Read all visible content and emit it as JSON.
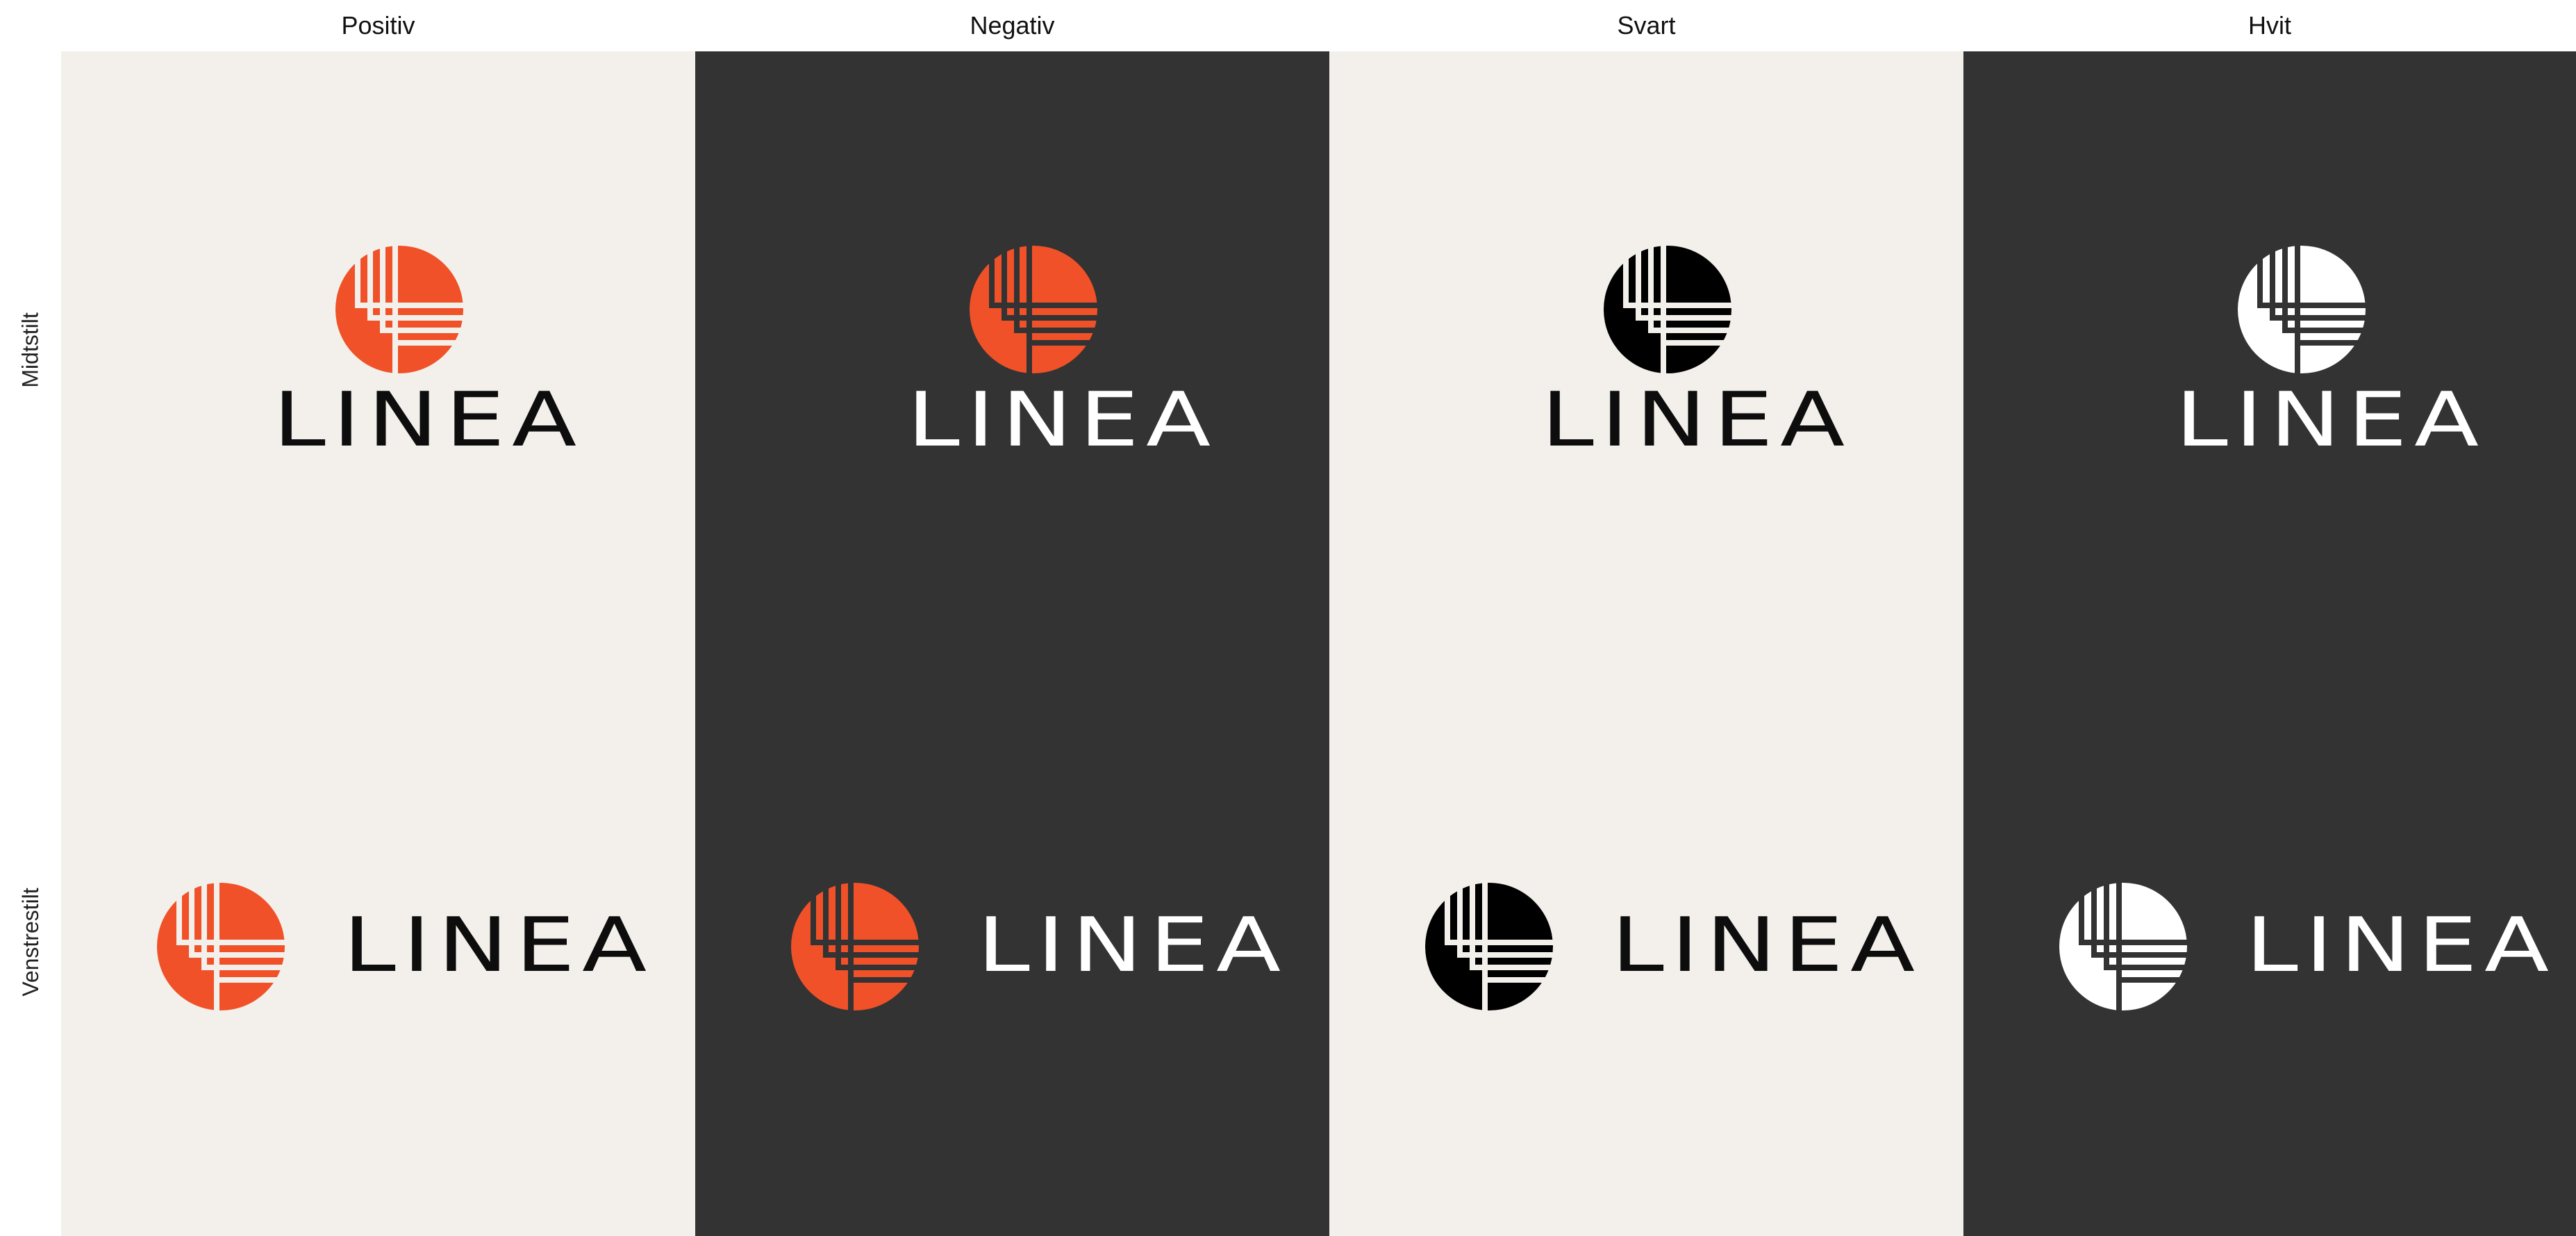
{
  "columns": [
    {
      "label": "Positiv",
      "bg": "#f3f0eb",
      "mark_color": "#f05128",
      "text_color": "#0d0d0d"
    },
    {
      "label": "Negativ",
      "bg": "#333333",
      "mark_color": "#f05128",
      "text_color": "#ffffff"
    },
    {
      "label": "Svart",
      "bg": "#f3f0eb",
      "mark_color": "#000000",
      "text_color": "#0d0d0d"
    },
    {
      "label": "Hvit",
      "bg": "#333333",
      "mark_color": "#ffffff",
      "text_color": "#ffffff"
    }
  ],
  "rows": [
    {
      "label": "Midtstilt"
    },
    {
      "label": "Venstrestilt"
    }
  ],
  "logo": {
    "wordmark": "LINEA",
    "icon": "linea-circle-grid-icon"
  }
}
